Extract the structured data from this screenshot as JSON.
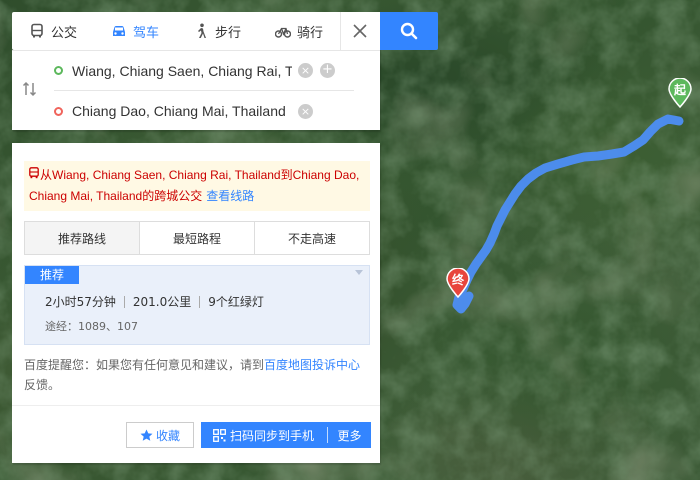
{
  "modes": [
    {
      "label": "公交",
      "icon": "bus-icon",
      "active": false
    },
    {
      "label": "驾车",
      "icon": "car-icon",
      "active": true
    },
    {
      "label": "步行",
      "icon": "walk-icon",
      "active": false
    },
    {
      "label": "骑行",
      "icon": "bike-icon",
      "active": false
    }
  ],
  "route": {
    "start": "Wiang, Chiang Saen, Chiang Rai, Thailand",
    "end": "Chiang Dao, Chiang Mai, Thailand"
  },
  "notice": {
    "prefix": "从",
    "start": "Wiang, Chiang Saen, Chiang Rai, Thailand",
    "to": "到",
    "end": "Chiang Dao, Chiang Mai, Thailand",
    "suffix": "的跨城公交",
    "link": "查看线路"
  },
  "tabs": [
    "推荐路线",
    "最短路程",
    "不走高速"
  ],
  "plan": {
    "badge": "推荐",
    "duration": "2小时57分钟",
    "distance": "201.0公里",
    "lights": "9个红绿灯",
    "via": "途经：1089、107"
  },
  "tip": {
    "text": "百度提醒您：如果您有任何意见和建议，请到",
    "link": "百度地图投诉中心",
    "end": "反馈。"
  },
  "buttons": {
    "favorite": "收藏",
    "scan": "扫码同步到手机",
    "more": "更多"
  },
  "markers": {
    "start": "起",
    "end": "终"
  },
  "colors": {
    "accent": "#3385ff",
    "route": "#4d8ef5",
    "start_marker": "#5cb85c",
    "end_marker": "#e8453c"
  }
}
